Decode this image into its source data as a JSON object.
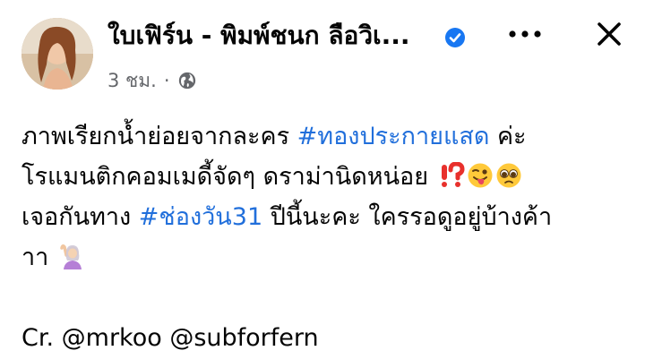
{
  "post": {
    "author_name": "ใบเฟิร์น - พิมพ์ชนก ลือวิเ...",
    "verified": true,
    "timestamp": "3 ชม.",
    "separator": "·",
    "audience_icon": "globe-icon",
    "more_icon": "more-options-icon",
    "close_icon": "close-icon",
    "lines": {
      "line1_text": "ภาพเรียกน้ำย่อยจากละคร ",
      "line1_hashtag": "#ทองประกายแสด",
      "line1_end": " ค่ะ",
      "line2_text": "โรแมนติกคอมเมดี้จัดๆ ดราม่านิดหน่อย ",
      "line2_emojis": [
        "exclamation-question-mark-emoji",
        "winking-tongue-face-emoji",
        "pleading-face-emoji"
      ],
      "line3_text": "เจอกันทาง ",
      "line3_hashtag": "#ช่องวัน31",
      "line3_end": " ปีนี้นะคะ ใครรอดูอยู่บ้างค้า",
      "line4_text": "าา ",
      "line4_emojis": [
        "person-raising-hand-emoji"
      ],
      "credit": "Cr. @mrkoo @subforfern"
    },
    "colors": {
      "hashtag": "#216fdb",
      "secondary_text": "#65676b",
      "verified_badge": "#1877f2",
      "primary_text": "#050505"
    }
  }
}
